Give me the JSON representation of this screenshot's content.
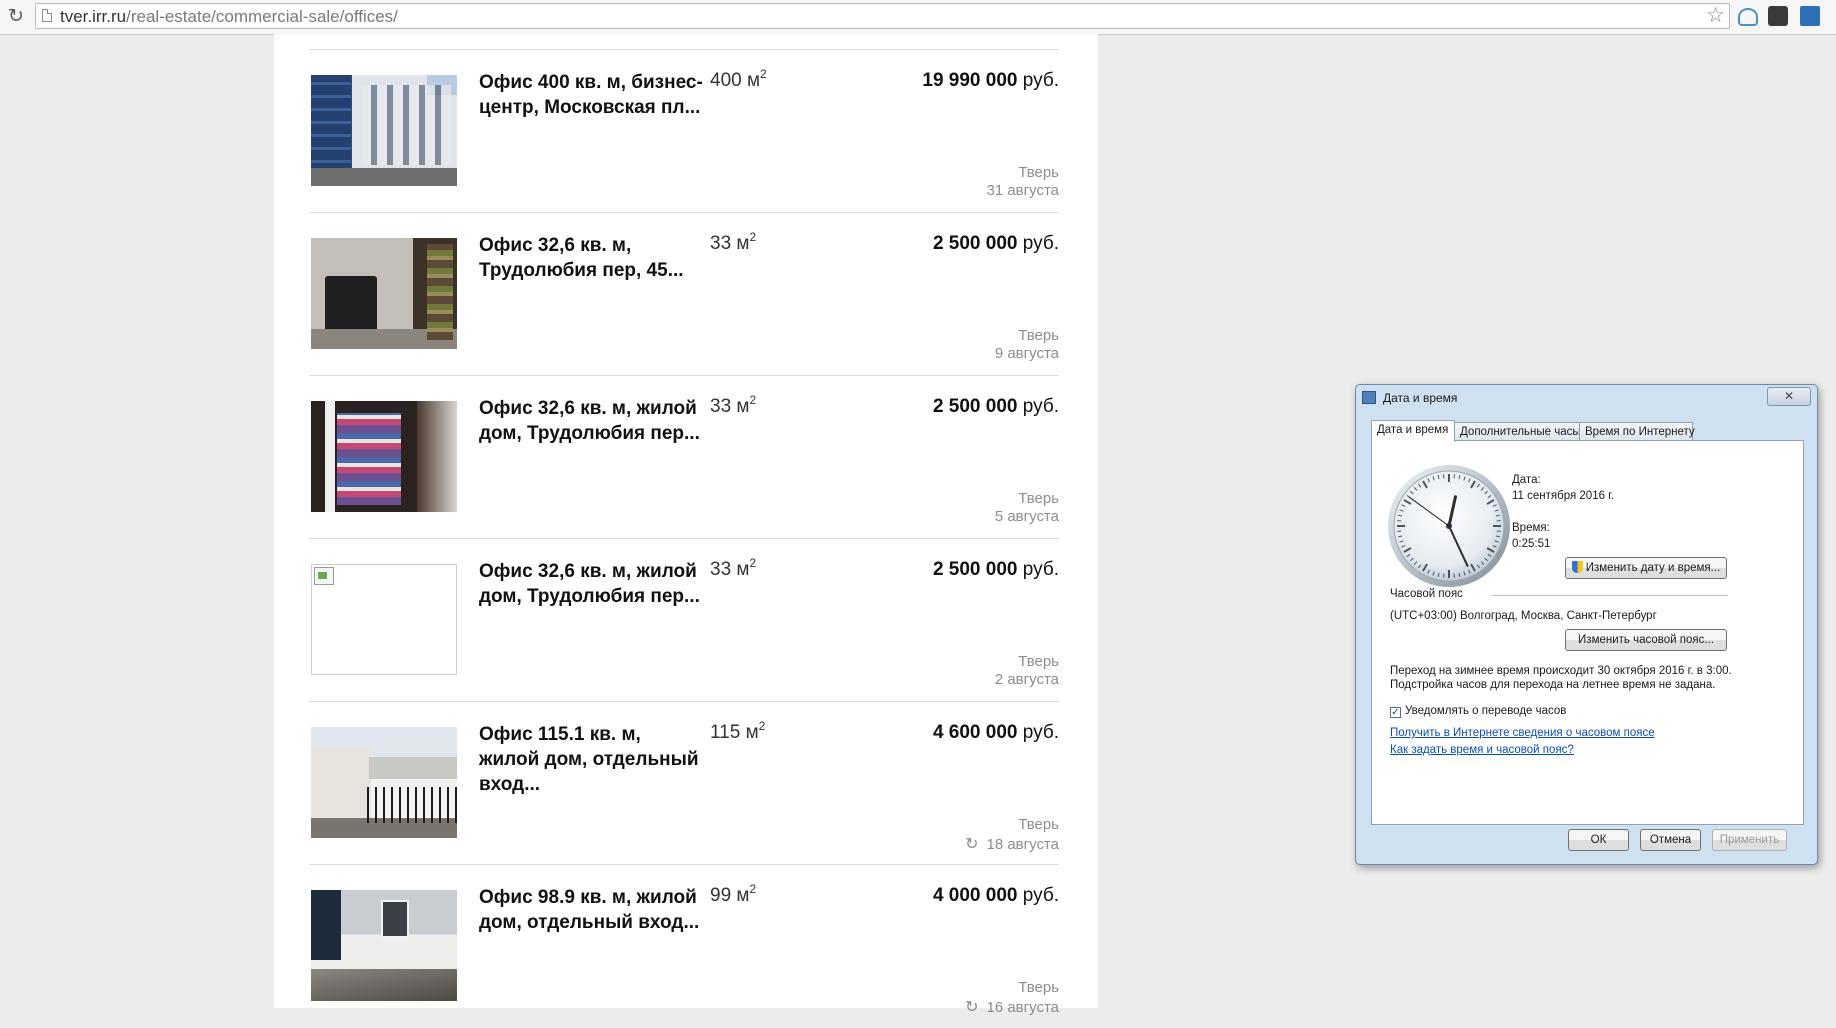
{
  "browser": {
    "url_host": "tver.irr.ru",
    "url_path": "/real-estate/commercial-sale/offices/"
  },
  "listings": [
    {
      "title": "Офис 400 кв. м, бизнес-центр, Московская пл...",
      "area": "400 м",
      "area_sup": "2",
      "price": "19 990 000",
      "currency": "руб.",
      "city": "Тверь",
      "date": "31 августа",
      "refreshed": false
    },
    {
      "title": "Офис 32,6 кв. м, Трудолюбия пер, 45...",
      "area": "33 м",
      "area_sup": "2",
      "price": "2 500 000",
      "currency": "руб.",
      "city": "Тверь",
      "date": "9 августа",
      "refreshed": false
    },
    {
      "title": "Офис 32,6 кв. м, жилой дом, Трудолюбия пер...",
      "area": "33 м",
      "area_sup": "2",
      "price": "2 500 000",
      "currency": "руб.",
      "city": "Тверь",
      "date": "5 августа",
      "refreshed": false
    },
    {
      "title": "Офис 32,6 кв. м, жилой дом, Трудолюбия пер...",
      "area": "33 м",
      "area_sup": "2",
      "price": "2 500 000",
      "currency": "руб.",
      "city": "Тверь",
      "date": "2 августа",
      "refreshed": false
    },
    {
      "title": "Офис 115.1 кв. м, жилой дом, отдельный вход...",
      "area": "115 м",
      "area_sup": "2",
      "price": "4 600 000",
      "currency": "руб.",
      "city": "Тверь",
      "date": "18 августа",
      "refreshed": true
    },
    {
      "title": "Офис 98.9 кв. м, жилой дом, отдельный вход...",
      "area": "99 м",
      "area_sup": "2",
      "price": "4 000 000",
      "currency": "руб.",
      "city": "Тверь",
      "date": "16 августа",
      "refreshed": true
    }
  ],
  "dialog": {
    "title": "Дата и время",
    "close_label": "✕",
    "tabs": [
      "Дата и время",
      "Дополнительные часы",
      "Время по Интернету"
    ],
    "date_label": "Дата:",
    "date_value": "11 сентября 2016 г.",
    "time_label": "Время:",
    "time_value": "0:25:51",
    "change_datetime_button": "Изменить дату и время...",
    "timezone_label": "Часовой пояс",
    "timezone_value": "(UTC+03:00) Волгоград, Москва, Санкт-Петербург",
    "change_timezone_button": "Изменить часовой пояс...",
    "dst_line1": "Переход на зимнее время происходит 30 октября 2016 г. в 3:00.",
    "dst_line2": "Подстройка часов для перехода на летнее время не задана.",
    "notify_checkbox_label": "Уведомлять о переводе часов",
    "notify_checked": true,
    "link_timezone_info": "Получить в Интернете сведения о часовом поясе",
    "link_how_to_set": "Как задать время и часовой пояс?",
    "ok_button": "ОК",
    "cancel_button": "Отмена",
    "apply_button": "Применить",
    "clock": {
      "hours": 0,
      "minutes": 25,
      "seconds": 51
    }
  }
}
